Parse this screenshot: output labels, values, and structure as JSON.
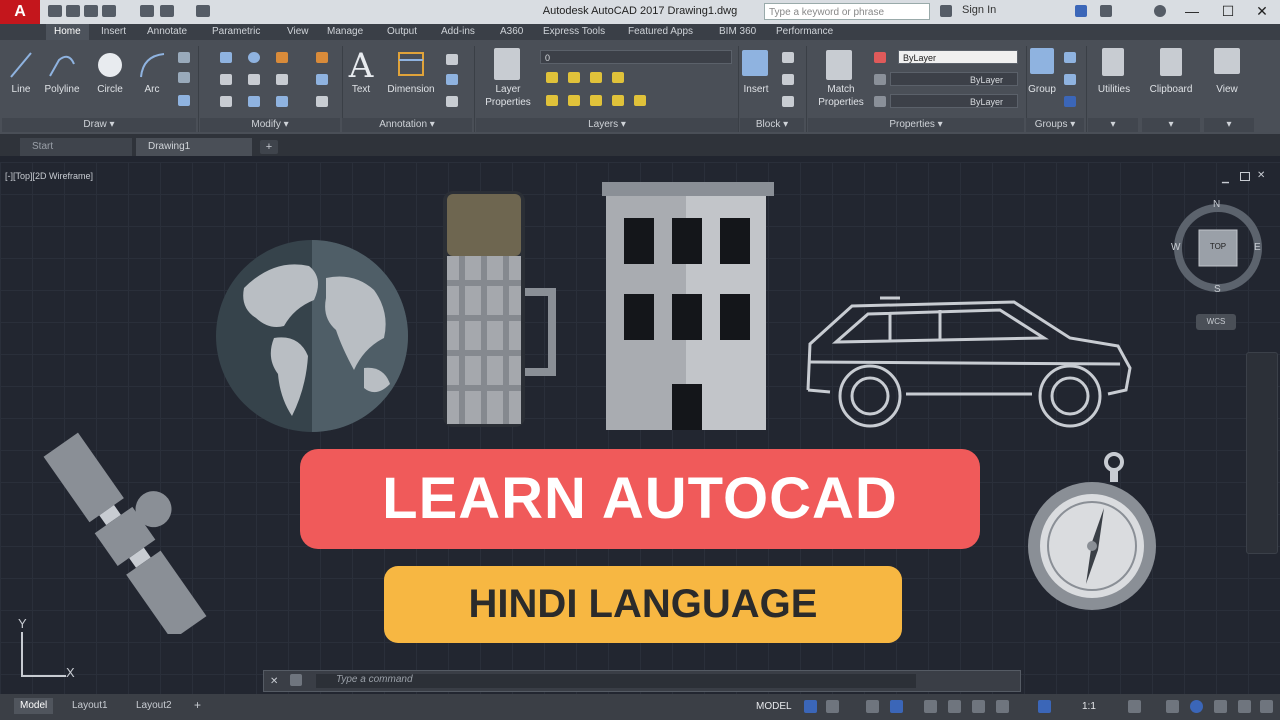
{
  "app": {
    "window_title": "Autodesk AutoCAD 2017    Drawing1.dwg",
    "logo": "A",
    "search_placeholder": "Type a keyword or phrase",
    "sign_in": "Sign In",
    "win_min": "—",
    "win_max": "☐",
    "win_close": "✕"
  },
  "ribbon": {
    "tabs": [
      "Home",
      "Insert",
      "Annotate",
      "Parametric",
      "View",
      "Manage",
      "Output",
      "Add-ins",
      "A360",
      "Express Tools",
      "Featured Apps",
      "BIM 360",
      "Performance"
    ],
    "tools": {
      "line": "Line",
      "polyline": "Polyline",
      "circle": "Circle",
      "arc": "Arc",
      "text": "Text",
      "dimension": "Dimension",
      "layer_properties_1": "Layer",
      "layer_properties_2": "Properties",
      "insert": "Insert",
      "match_1": "Match",
      "match_2": "Properties",
      "group": "Group",
      "utilities": "Utilities",
      "clipboard": "Clipboard",
      "view": "View"
    },
    "layer_combo": "0",
    "bylayer_1": "ByLayer",
    "bylayer_2": "ByLayer",
    "bylayer_3": "ByLayer",
    "panels": {
      "draw": "Draw ▾",
      "modify": "Modify ▾",
      "annotation": "Annotation ▾",
      "layers": "Layers ▾",
      "block": "Block ▾",
      "properties": "Properties ▾",
      "groups": "Groups ▾",
      "arrow_1": "▾",
      "arrow_2": "▾",
      "arrow_3": "▾"
    }
  },
  "doc_tabs": {
    "start": "Start",
    "drawing": "Drawing1",
    "add": "+"
  },
  "canvas": {
    "view_label": "[-][Top][2D Wireframe]",
    "viewcube": {
      "top": "TOP",
      "n": "N",
      "s": "S",
      "e": "E",
      "w": "W",
      "wcs": "WCS"
    },
    "ucs_x": "X",
    "ucs_y": "Y"
  },
  "banner": {
    "title": "LEARN AUTOCAD",
    "subtitle": "HINDI LANGUAGE"
  },
  "command": {
    "placeholder": "Type a command"
  },
  "status": {
    "model_tab": "Model",
    "layout1": "Layout1",
    "layout2": "Layout2",
    "model_btn": "MODEL",
    "scale": "1:1"
  },
  "colors": {
    "banner_red": "#f05a5a",
    "banner_yellow": "#f7b742",
    "canvas_bg": "#222630"
  }
}
